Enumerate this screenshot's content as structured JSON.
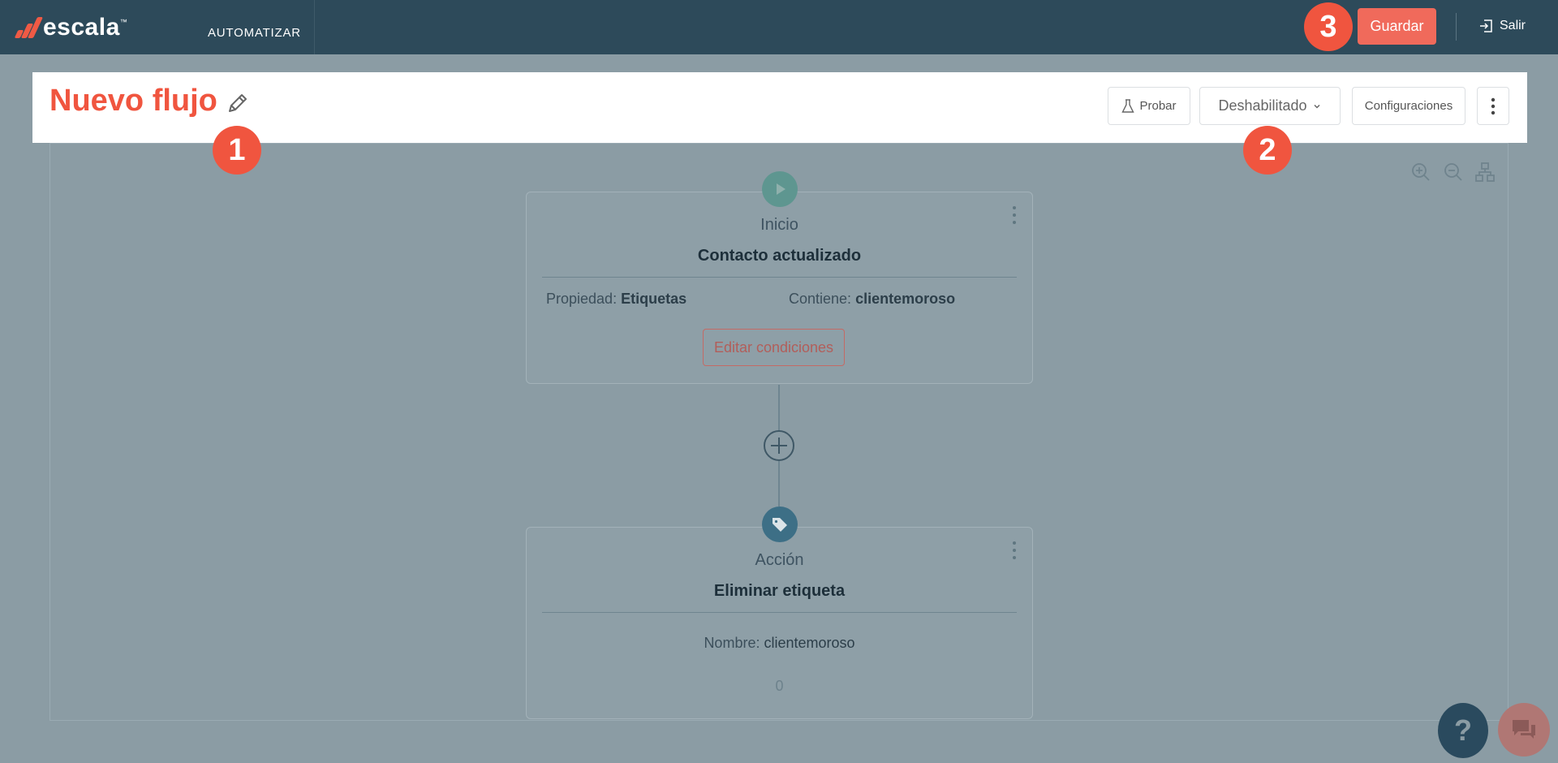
{
  "topbar": {
    "logo_text": "escala",
    "logo_tm": "™",
    "nav_label": "AUTOMATIZAR",
    "save_label": "Guardar",
    "exit_label": "Salir"
  },
  "header": {
    "title": "Nuevo flujo",
    "test_label": "Probar",
    "status_label": "Deshabilitado",
    "config_label": "Configuraciones"
  },
  "badges": [
    "1",
    "2",
    "3"
  ],
  "start_node": {
    "type": "Inicio",
    "title": "Contacto actualizado",
    "prop1_label": "Propiedad:",
    "prop1_value": "Etiquetas",
    "prop2_label": "Contiene:",
    "prop2_value": "clientemoroso",
    "edit_label": "Editar condiciones"
  },
  "action_node": {
    "type": "Acción",
    "title": "Eliminar etiqueta",
    "prop_label": "Nombre:",
    "prop_value": "clientemoroso",
    "count": "0"
  },
  "help_label": "?",
  "colors": {
    "nav_bg": "#2d4a5a",
    "accent": "#f0553f",
    "overlay": "#8b9ca4",
    "start_node": "#5e9690",
    "action_node": "#3d6f86"
  }
}
